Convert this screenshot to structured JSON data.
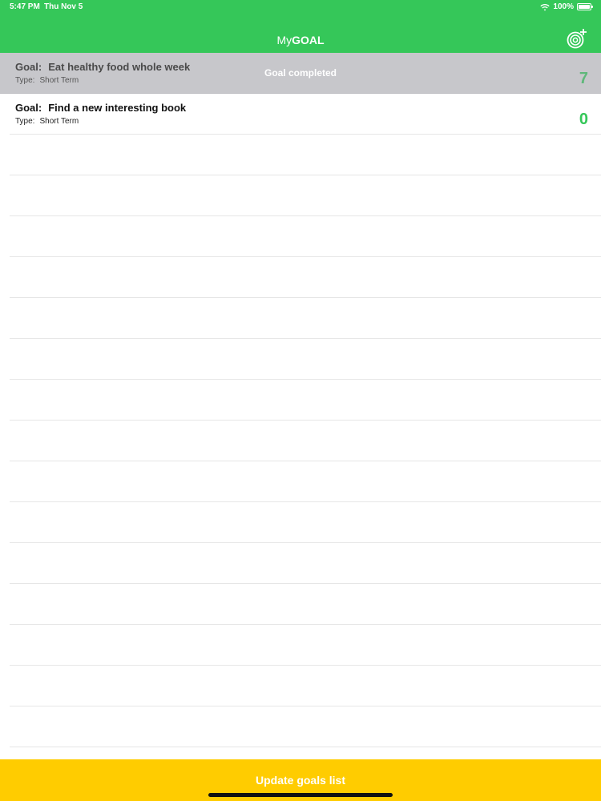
{
  "status_bar": {
    "time": "5:47 PM",
    "date": "Thu Nov 5",
    "battery": "100%"
  },
  "nav": {
    "title_prefix": "My",
    "title_suffix": "GOAL",
    "add_icon": "add-goal-target-icon"
  },
  "goals": [
    {
      "goal_label": "Goal:",
      "goal_text": "Eat healthy food whole week",
      "type_label": "Type:",
      "type_value": "Short Term",
      "count": "7",
      "status": "Goal completed"
    },
    {
      "goal_label": "Goal:",
      "goal_text": "Find a new interesting book",
      "type_label": "Type:",
      "type_value": "Short Term",
      "count": "0"
    }
  ],
  "update_button": {
    "label": "Update goals list"
  },
  "colors": {
    "header": "#35c759",
    "completed_row": "#c7c7cb",
    "count": "#35c759",
    "button": "#ffcc00"
  }
}
